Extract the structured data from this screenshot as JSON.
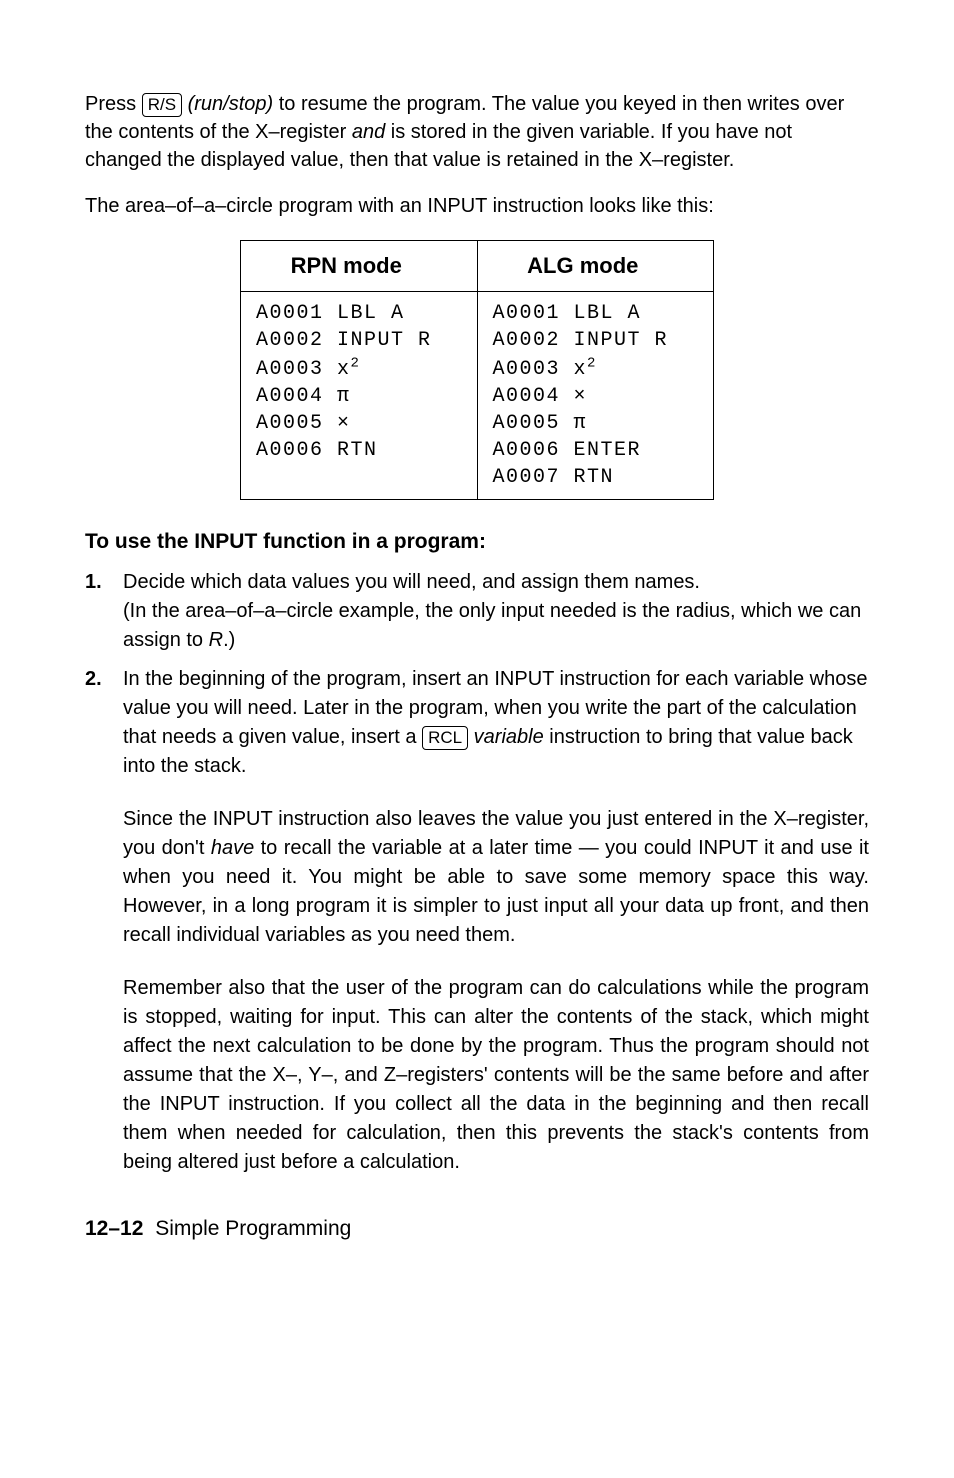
{
  "para1_pre": "Press ",
  "key_rs": "R/S",
  "para1_mid1": " ",
  "para1_runstop": "(run/stop)",
  "para1_mid2": " to resume the program. The value you keyed in then writes over the contents of the X–register ",
  "para1_and": "and",
  "para1_post": " is stored in the given variable. If you have not changed the displayed value, then that value is retained in the X–register.",
  "para2": "The area–of–a–circle program with an INPUT instruction looks like this:",
  "table": {
    "head_rpn": "RPN mode",
    "head_alg": "ALG mode",
    "rpn": [
      "A0001 LBL A",
      "A0002 INPUT R",
      "A0003 x",
      "A0004 π",
      "A0005 ×",
      "A0006 RTN"
    ],
    "alg": [
      "A0001 LBL A",
      "A0002 INPUT R",
      "A0003 x",
      "A0004 ×",
      "A0005 π",
      "A0006 ENTER",
      "A0007 RTN"
    ]
  },
  "heading": "To use the INPUT function in a program:",
  "li1_a": "Decide which data values you will need, and assign them names.",
  "li1_b_pre": "(In the area–of–a–circle example, the only input needed is the radius, which we can assign to ",
  "li1_b_R": "R",
  "li1_b_post": ".)",
  "li2_a_pre": "In the beginning of the program, insert an INPUT instruction for each variable whose value you will need. Later in the program, when you write the part of the calculation that needs a given value, insert a ",
  "key_rcl": "RCL",
  "li2_a_var": " variable",
  "li2_a_post": " instruction to bring that value back into the stack.",
  "li2_b_pre": "Since the INPUT instruction also leaves the value you just entered in the X–register, you don't ",
  "li2_b_have": "have",
  "li2_b_post": " to recall the variable at a later time — you could INPUT it and use it when you need it. You might be able to save some memory space this way. However, in a long program it is simpler to just input all your data up front, and then recall individual variables as you need them.",
  "li2_c": "Remember also that the user of the program can do calculations while the program is stopped, waiting for input. This can alter the contents of the stack, which might affect the next calculation to be done by the program. Thus the program should not assume that the X–, Y–, and Z–registers' contents will be the same before and after the INPUT instruction. If you collect all the data in the beginning and then recall them when needed for calculation, then this prevents the stack's contents from being altered just before a calculation.",
  "footer_num": "12–12",
  "footer_title": "Simple Programming"
}
